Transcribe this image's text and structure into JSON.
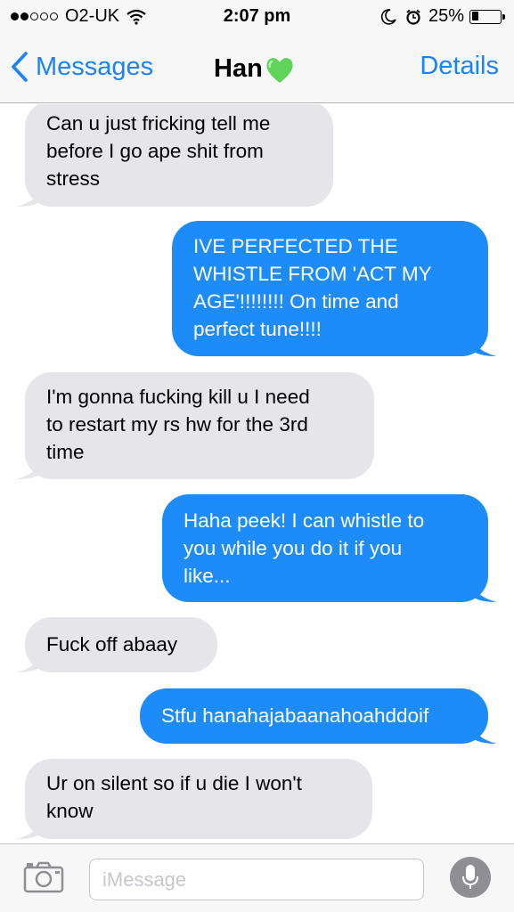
{
  "status_bar": {
    "carrier": "O2-UK",
    "signal_bars_filled": 2,
    "signal_bars_total": 5,
    "time": "2:07 pm",
    "battery_percent_label": "25%",
    "battery_level": 0.25,
    "icons": [
      "wifi-icon",
      "moon-icon",
      "alarm-icon",
      "battery-icon"
    ]
  },
  "nav": {
    "back_label": "Messages",
    "title": "Han",
    "title_emoji": "green-heart-icon",
    "details_label": "Details"
  },
  "messages": [
    {
      "direction": "incoming",
      "text": "Can u just fricking tell me\nbefore I go ape shit from\nstress"
    },
    {
      "direction": "outgoing",
      "text": "IVE PERFECTED THE\nWHISTLE FROM 'ACT MY\nAGE'!!!!!!!! On time and\nperfect tune!!!!"
    },
    {
      "direction": "incoming",
      "text": "I'm gonna fucking kill u I need\nto restart my rs hw for the 3rd\ntime"
    },
    {
      "direction": "outgoing",
      "text": "Haha peek! I can whistle to\nyou while you do it if you\nlike..."
    },
    {
      "direction": "incoming",
      "text": "Fuck off abaay"
    },
    {
      "direction": "outgoing",
      "text": "Stfu hanahajabaanahoahddoif"
    },
    {
      "direction": "incoming",
      "text": "Ur on silent so if u die I won't\nknow"
    }
  ],
  "input": {
    "placeholder": "iMessage",
    "value": ""
  },
  "colors": {
    "accent": "#1a82fb",
    "outgoing_bubble": "#1d8cf8",
    "incoming_bubble": "#e5e5ea",
    "heart": "#5fd35a"
  }
}
